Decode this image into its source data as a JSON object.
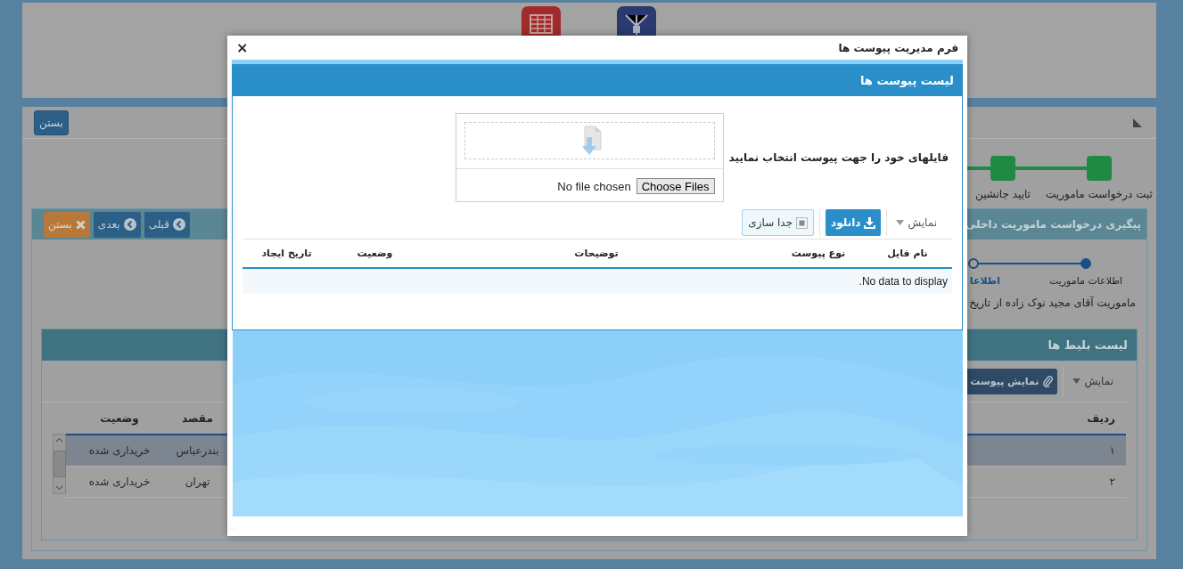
{
  "main_panel": {
    "close_button": "بستن",
    "workflow": [
      {
        "label": "ثبت درخواست ماموریت",
        "done": true
      },
      {
        "label": "تایید جانشین",
        "done": true
      }
    ]
  },
  "request_panel": {
    "title": "پیگیری درخواست ماموریت داخلی",
    "buttons": [
      {
        "label": "قبلی",
        "kind": "prev"
      },
      {
        "label": "بعدی",
        "kind": "next"
      },
      {
        "label": "بستن",
        "kind": "close"
      }
    ],
    "steps": [
      {
        "label": "اطلاعات ماموریت",
        "selected": false
      },
      {
        "label": "اطلاعا",
        "selected": true
      }
    ],
    "summary": "ماموریت آقای مجید نوک زاده از تاریخ"
  },
  "tickets": {
    "title": "لیست بلیط ها",
    "view_menu": "نمایش",
    "attachments_button": "نمایش پیوست",
    "columns": [
      "ردیف",
      "مقصد",
      "وضعیت"
    ],
    "rows": [
      {
        "cells": [
          "١",
          "بندرعباس",
          "خریداری شده"
        ],
        "selected": true
      },
      {
        "cells": [
          "٢",
          "تهران",
          "خریداری شده"
        ],
        "selected": false
      }
    ]
  },
  "dialog": {
    "title": "فرم مدیریت پیوست ها",
    "close": "×",
    "header": "لیست پیوست ها",
    "upload_label": "فایلهای خود را جهت پیوست انتخاب نمایید",
    "file_status": "No file chosen",
    "choose_button": "Choose Files",
    "view_menu": "نمایش",
    "download_button": "دانلود",
    "detach_button": "جدا سازی",
    "columns": [
      "نام فایل",
      "نوع پیوست",
      "توضیحات",
      "وضعیت",
      "تاریخ ایجاد"
    ],
    "empty_text": "No data to display."
  }
}
